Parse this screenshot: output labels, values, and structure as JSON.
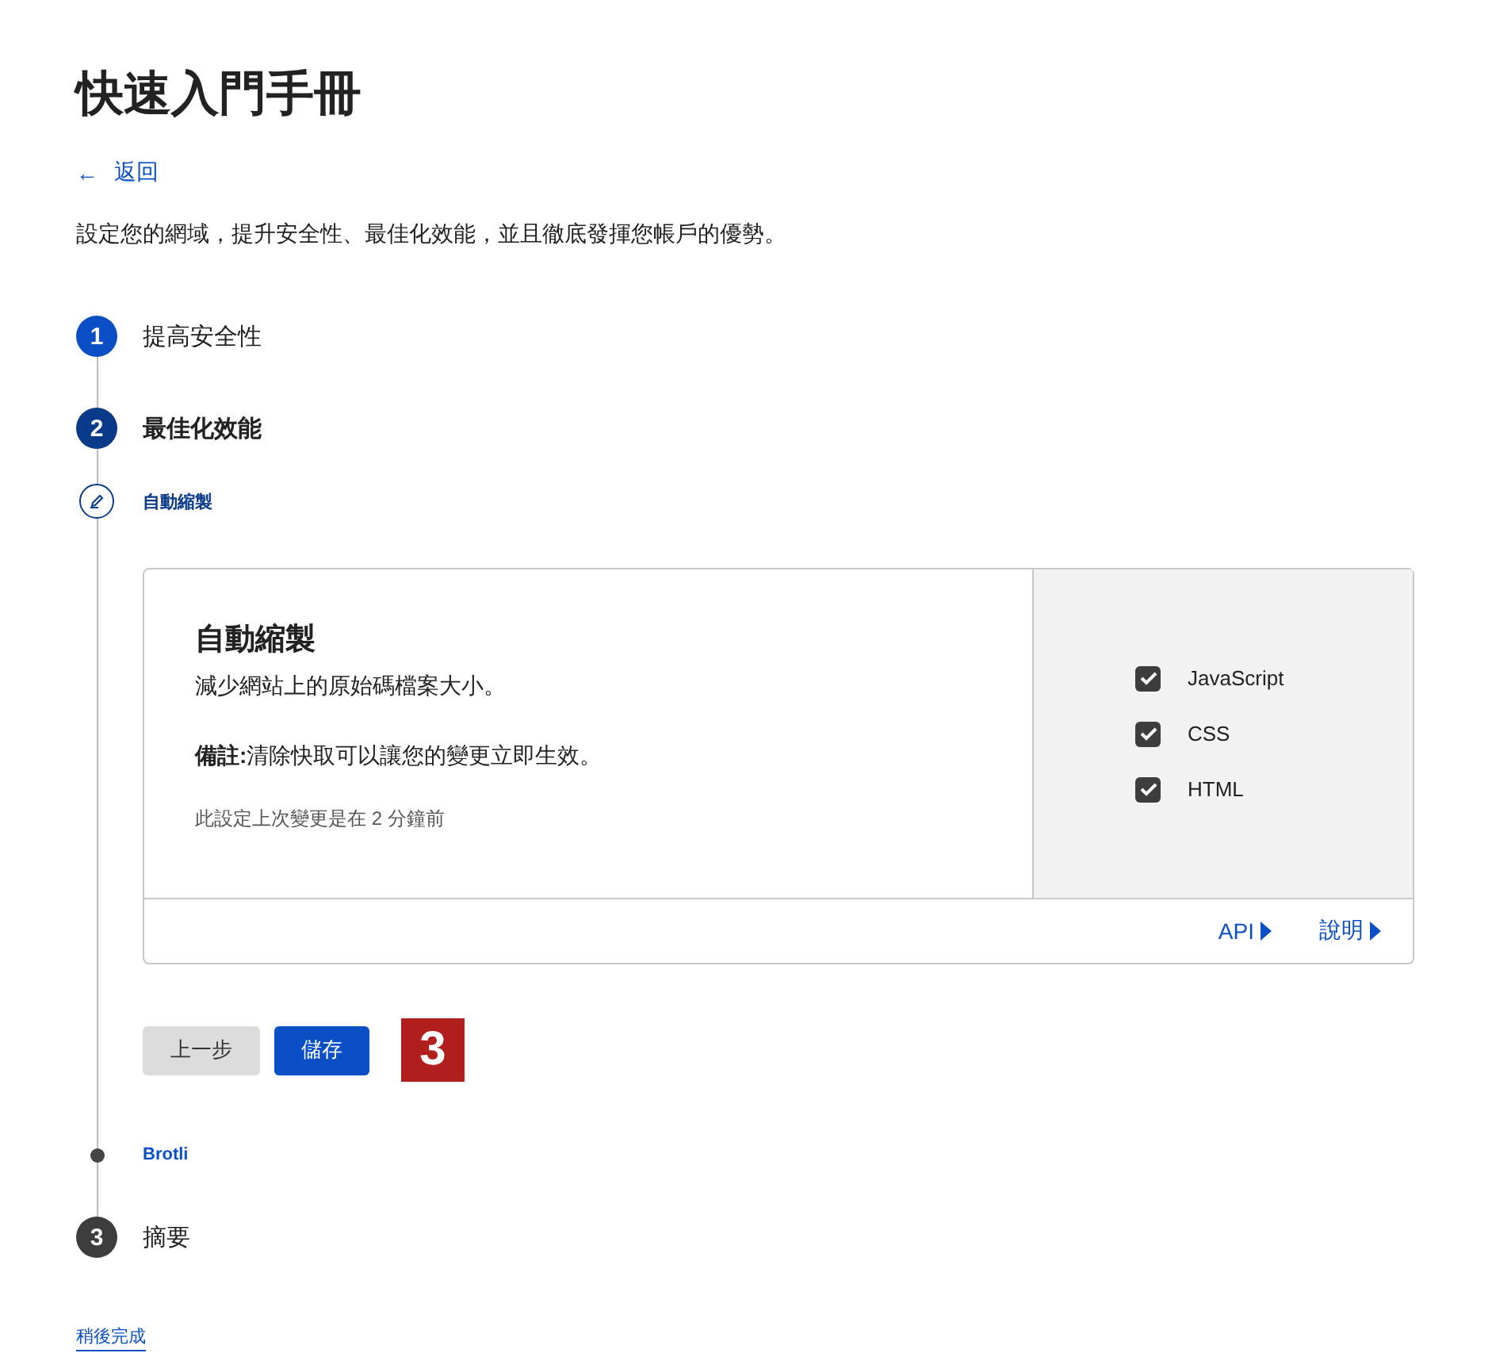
{
  "title": "快速入門手冊",
  "back_link": {
    "arrow": "←",
    "label": "返回"
  },
  "description": "設定您的網域，提升安全性、最佳化效能，並且徹底發揮您帳戶的優勢。",
  "steps": [
    {
      "number": "1",
      "label": "提高安全性",
      "completed": true,
      "current": false
    },
    {
      "number": "2",
      "label": "最佳化效能",
      "completed": false,
      "current": true,
      "substeps": [
        {
          "label": "自動縮製",
          "current": true,
          "panel": {
            "title": "自動縮製",
            "description": "減少網站上的原始碼檔案大小。",
            "note": "**備註:**清除快取可以讓您的變更立即生效。",
            "last_changed": "此設定上次變更是在 2 分鐘前",
            "options": [
              {
                "label": "JavaScript",
                "checked": true
              },
              {
                "label": "CSS",
                "checked": true
              },
              {
                "label": "HTML",
                "checked": true
              }
            ],
            "links": [
              "API",
              "說明"
            ],
            "buttons": [
              {
                "label": "上一步",
                "kind": "secondary"
              },
              {
                "label": "儲存",
                "kind": "primary"
              }
            ],
            "callout": "3"
          }
        },
        {
          "label": "Brotli",
          "current": false
        }
      ]
    },
    {
      "number": "3",
      "label": "摘要",
      "completed": false,
      "current": false
    }
  ],
  "finish_later": "稍後完成"
}
